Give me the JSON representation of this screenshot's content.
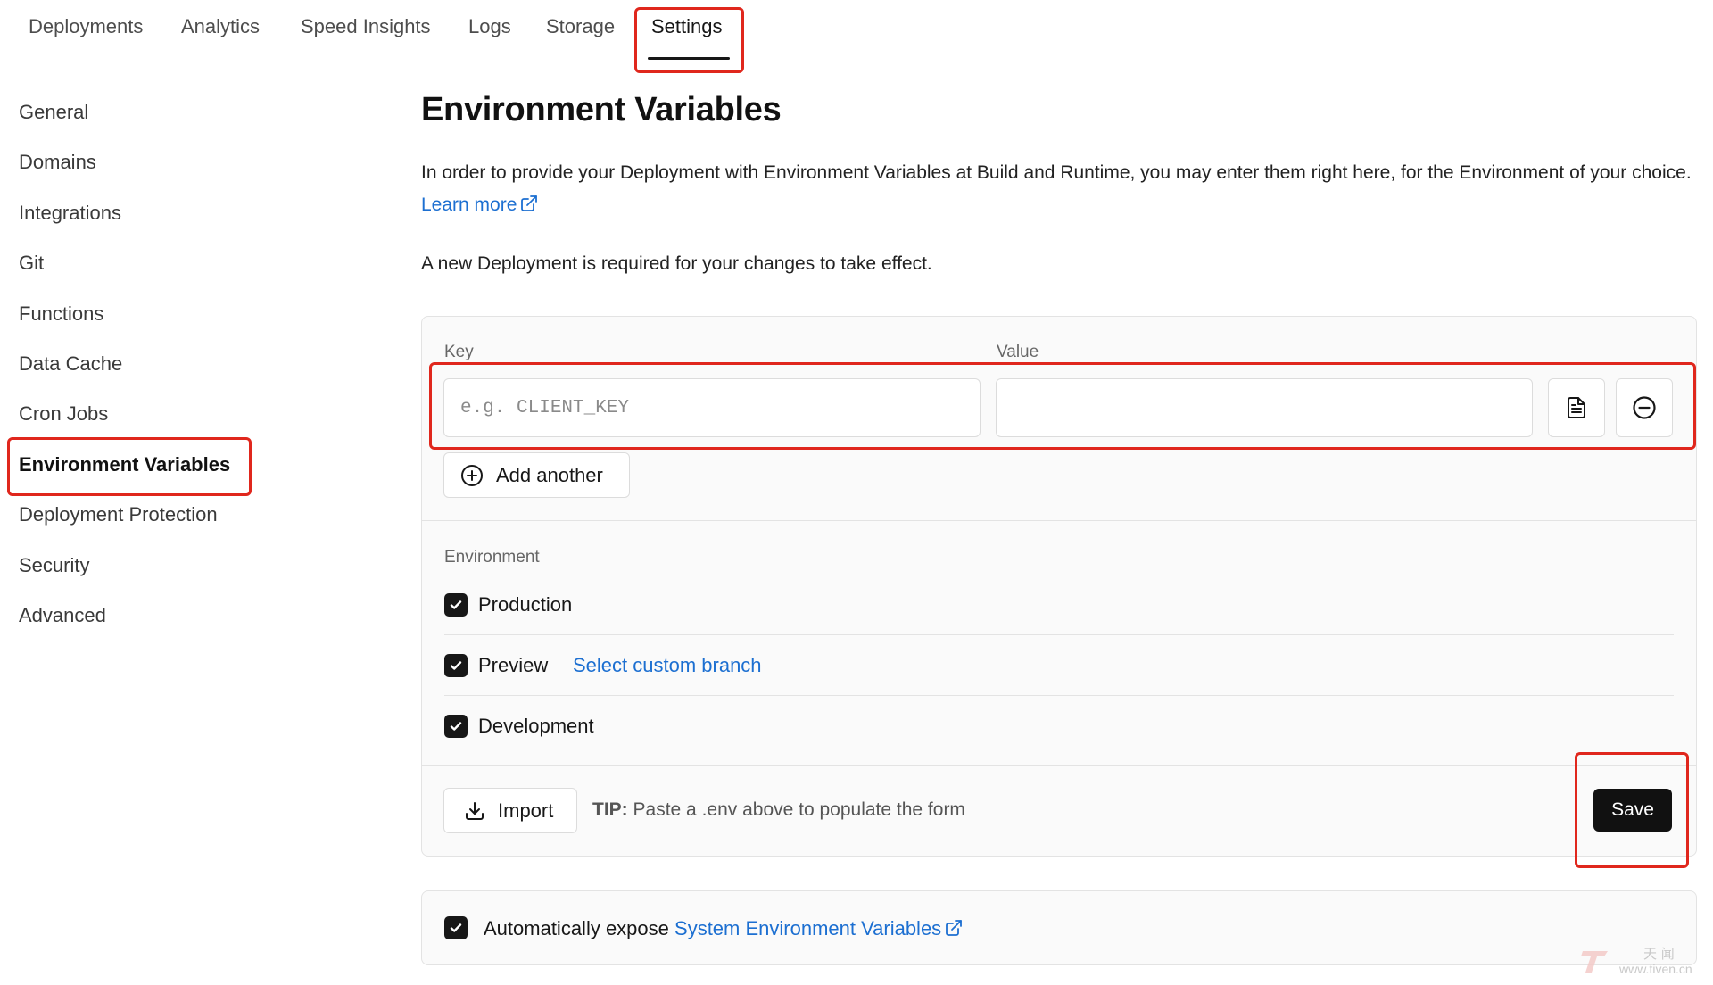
{
  "top_tabs": [
    "Deployments",
    "Analytics",
    "Speed Insights",
    "Logs",
    "Storage",
    "Settings"
  ],
  "active_tab": "Settings",
  "sidebar": {
    "items": [
      {
        "label": "General"
      },
      {
        "label": "Domains"
      },
      {
        "label": "Integrations"
      },
      {
        "label": "Git"
      },
      {
        "label": "Functions"
      },
      {
        "label": "Data Cache"
      },
      {
        "label": "Cron Jobs"
      },
      {
        "label": "Environment Variables"
      },
      {
        "label": "Deployment Protection"
      },
      {
        "label": "Security"
      },
      {
        "label": "Advanced"
      }
    ],
    "active": "Environment Variables"
  },
  "main": {
    "title": "Environment Variables",
    "description": "In order to provide your Deployment with Environment Variables at Build and Runtime, you may enter them right here, for the Environment of your choice.",
    "learn_more": "Learn more",
    "note": "A new Deployment is required for your changes to take effect."
  },
  "form": {
    "key_label": "Key",
    "value_label": "Value",
    "key_placeholder": "e.g. CLIENT_KEY",
    "key_value": "",
    "value_value": "",
    "add_another": "Add another",
    "environment_label": "Environment",
    "environments": [
      {
        "label": "Production",
        "checked": true
      },
      {
        "label": "Preview",
        "checked": true,
        "link": "Select custom branch"
      },
      {
        "label": "Development",
        "checked": true
      }
    ],
    "import_label": "Import",
    "tip_prefix": "TIP:",
    "tip_text": "Paste a .env above to populate the form",
    "save_label": "Save"
  },
  "system_vars": {
    "checked": true,
    "prefix": "Automatically expose",
    "link": "System Environment Variables"
  },
  "watermark": {
    "cn": "天 闻",
    "url": "www.tiven.cn"
  },
  "colors": {
    "accent_link": "#1c6fd1",
    "highlight_red": "#e0271d",
    "primary_button": "#111111",
    "checkbox": "#171717"
  }
}
